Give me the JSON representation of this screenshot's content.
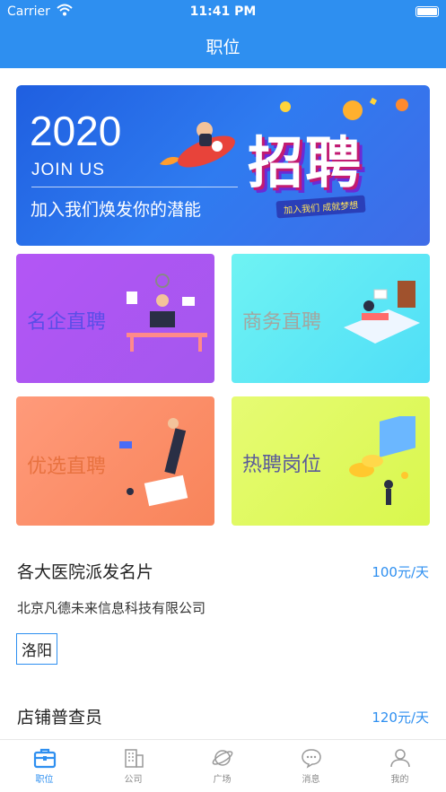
{
  "status": {
    "carrier": "Carrier",
    "time": "11:41 PM"
  },
  "header": {
    "title": "职位"
  },
  "banner": {
    "year": "2020",
    "join": "JOIN US",
    "slogan": "加入我们焕发你的潜能",
    "big_text": "招聘",
    "tag": "加入我们 成就梦想"
  },
  "tiles": [
    {
      "label": "名企直聘"
    },
    {
      "label": "商务直聘"
    },
    {
      "label": "优选直聘"
    },
    {
      "label": "热聘岗位"
    }
  ],
  "jobs": [
    {
      "title": "各大医院派发名片",
      "salary": "100元/天",
      "company": "北京凡德未来信息科技有限公司",
      "city": "洛阳"
    },
    {
      "title": "店铺普查员",
      "salary": "120元/天"
    }
  ],
  "tabbar": [
    {
      "label": "职位",
      "icon": "briefcase-icon",
      "active": true
    },
    {
      "label": "公司",
      "icon": "building-icon"
    },
    {
      "label": "广场",
      "icon": "planet-icon"
    },
    {
      "label": "消息",
      "icon": "chat-bubble-icon"
    },
    {
      "label": "我的",
      "icon": "person-icon"
    }
  ],
  "colors": {
    "primary": "#2e8ff0"
  }
}
